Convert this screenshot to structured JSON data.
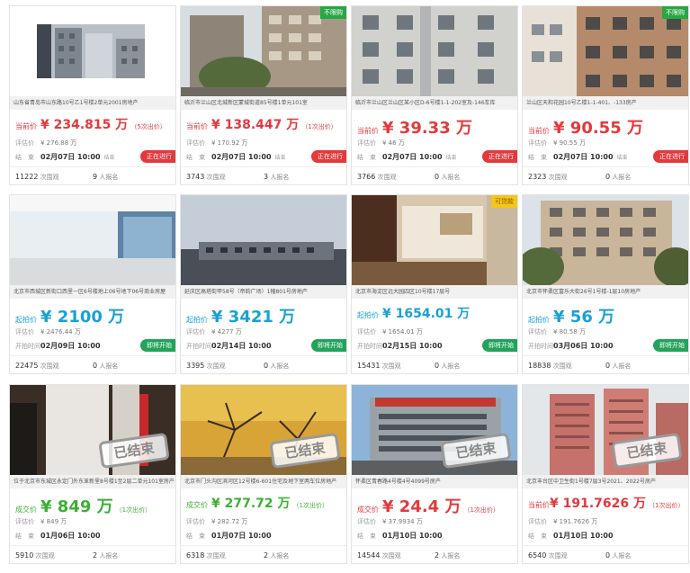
{
  "labels": {
    "appraisal": "评估价",
    "start_time": "开拍时间",
    "end_time": "结　束",
    "views_suffix": "次围观",
    "signups_suffix": "人报名",
    "end_suffix": "结束"
  },
  "cards": [
    {
      "corner": "",
      "caption": "山东省青岛市山东路10号乙1号楼2单元2001房地产",
      "price_label": "当前价",
      "price": "¥ 234.815 万",
      "count": "（5次出价）",
      "appraisal": "¥ 276.88 万",
      "time_label": "结　束",
      "time": "02月07日 10:00",
      "status": "正在进行",
      "views": "11222",
      "signups": "9"
    },
    {
      "corner": "不限购",
      "caption": "临沂市兰山区北城新区蒙城街道85号楼1单元101室",
      "price_label": "当前价",
      "price": "¥ 138.447 万",
      "count": "（1次出价）",
      "appraisal": "¥ 170.92 万",
      "time_label": "结　束",
      "time": "02月07日 10:00",
      "status": "正在进行",
      "views": "3743",
      "signups": "3"
    },
    {
      "corner": "",
      "caption": "临沂市兰山区兰山区某小区D-6号楼1-1-202室及-146车库",
      "price_label": "当前价",
      "price": "¥ 39.33 万",
      "count": "",
      "appraisal": "¥ 46 万",
      "time_label": "结　束",
      "time": "02月07日 10:00",
      "status": "正在进行",
      "views": "3766",
      "signups": "0"
    },
    {
      "corner": "不限购",
      "caption": "兰山区天和花园10号乙楼1-1-401、-133房产",
      "price_label": "当前价",
      "price": "¥ 90.55 万",
      "count": "",
      "appraisal": "¥ 90.55 万",
      "time_label": "结　束",
      "time": "02月07日 10:00",
      "status": "正在进行",
      "views": "2323",
      "signups": "0"
    },
    {
      "corner": "",
      "caption": "北京市西城区新街口西里一区6号楼地上06号地下06号商业房屋",
      "price_label": "起拍价",
      "price": "¥ 2100 万",
      "count": "",
      "appraisal": "¥ 2476.44 万",
      "time_label": "开拍时间",
      "time": "02月09日 10:00",
      "status": "即将开始",
      "views": "22475",
      "signups": "0"
    },
    {
      "corner": "",
      "caption": "延庆区高塔街甲58号（帝韵广场）1幢801号房地产",
      "price_label": "起拍价",
      "price": "¥ 3421 万",
      "count": "",
      "appraisal": "¥ 4277 万",
      "time_label": "开拍时间",
      "time": "02月14日 10:00",
      "status": "即将开始",
      "views": "3395",
      "signups": "0"
    },
    {
      "corner": "可贷款",
      "caption": "北京市海淀区远大园四区10号楼17层号",
      "price_label": "起拍价",
      "price": "¥ 1654.01 万",
      "count": "",
      "appraisal": "¥ 1654.01 万",
      "time_label": "开拍时间",
      "time": "02月15日 10:00",
      "status": "即将开始",
      "views": "15431",
      "signups": "0"
    },
    {
      "corner": "",
      "caption": "北京市怀柔区富乐大街26号1号楼-1层10房地产",
      "price_label": "起拍价",
      "price": "¥ 56 万",
      "count": "",
      "appraisal": "¥ 80.58 万",
      "time_label": "开拍时间",
      "time": "03月06日 10:00",
      "status": "即将开始",
      "views": "18838",
      "signups": "0"
    },
    {
      "corner": "",
      "caption": "位于北京市东城区永定门外东革新里8号楼1至2层二单元101室房产",
      "price_label": "成交价",
      "price": "¥ 849 万",
      "count": "（1次出价）",
      "appraisal": "¥ 849 万",
      "time_label": "结　束",
      "time": "01月06日 10:00",
      "status": "",
      "views": "5910",
      "signups": "2",
      "stamp": "已结束"
    },
    {
      "corner": "",
      "caption": "北京市门头沟区滨河区12号楼6-601住宅及地下室两车位房地产",
      "price_label": "成交价",
      "price": "¥ 277.72 万",
      "count": "（1次出价）",
      "appraisal": "¥ 282.72 万",
      "time_label": "结　束",
      "time": "01月07日 10:00",
      "status": "",
      "views": "6318",
      "signups": "2",
      "stamp": "已结束"
    },
    {
      "corner": "",
      "caption": "怀柔区青春路4号楼4号4099号房产",
      "price_label": "成交价",
      "price": "¥ 24.4 万",
      "count": "（1次出价）",
      "appraisal": "¥ 37.9934 万",
      "time_label": "结　束",
      "time": "01月10日 10:00",
      "status": "",
      "views": "14544",
      "signups": "2",
      "stamp": "已结束"
    },
    {
      "corner": "",
      "caption": "北京丰台区中卫生街1号楼7层3号2021、2022号房产",
      "price_label": "当前价",
      "price": "¥ 191.7626 万",
      "count": "（1次出价）",
      "appraisal": "¥ 191.7626 万",
      "time_label": "结　束",
      "time": "01月10日 10:00",
      "status": "",
      "views": "6540",
      "signups": "0",
      "stamp": "已结束"
    }
  ]
}
